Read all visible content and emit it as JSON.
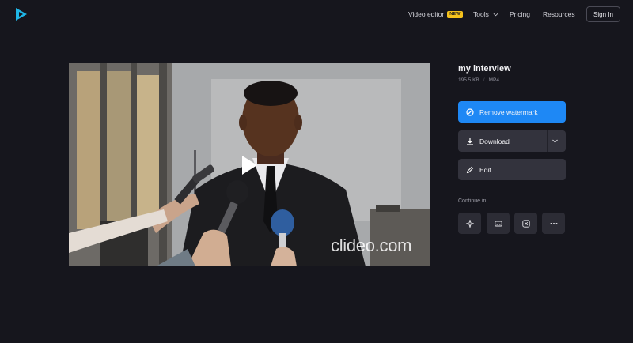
{
  "header": {
    "logo": "clideo-play-logo",
    "nav": {
      "video_editor": "Video editor",
      "video_editor_badge": "NEW",
      "tools": "Tools",
      "pricing": "Pricing",
      "resources": "Resources"
    },
    "signin": "Sign In"
  },
  "video": {
    "watermark": "clideo.com",
    "play_icon": "play-icon"
  },
  "file": {
    "name": "my interview",
    "size": "195.5 KB",
    "separator": "/",
    "format": "MP4"
  },
  "actions": {
    "remove_watermark": "Remove watermark",
    "download": "Download",
    "edit": "Edit"
  },
  "continue": {
    "label": "Continue in...",
    "tools": [
      "sparkle-icon",
      "subtitles-icon",
      "edit-video-icon",
      "more-icon"
    ]
  },
  "colors": {
    "background": "#16161d",
    "primary": "#1e88f5",
    "secondary_button": "#33333d",
    "badge": "#f6c21c",
    "logo": "#1fb6e6"
  }
}
